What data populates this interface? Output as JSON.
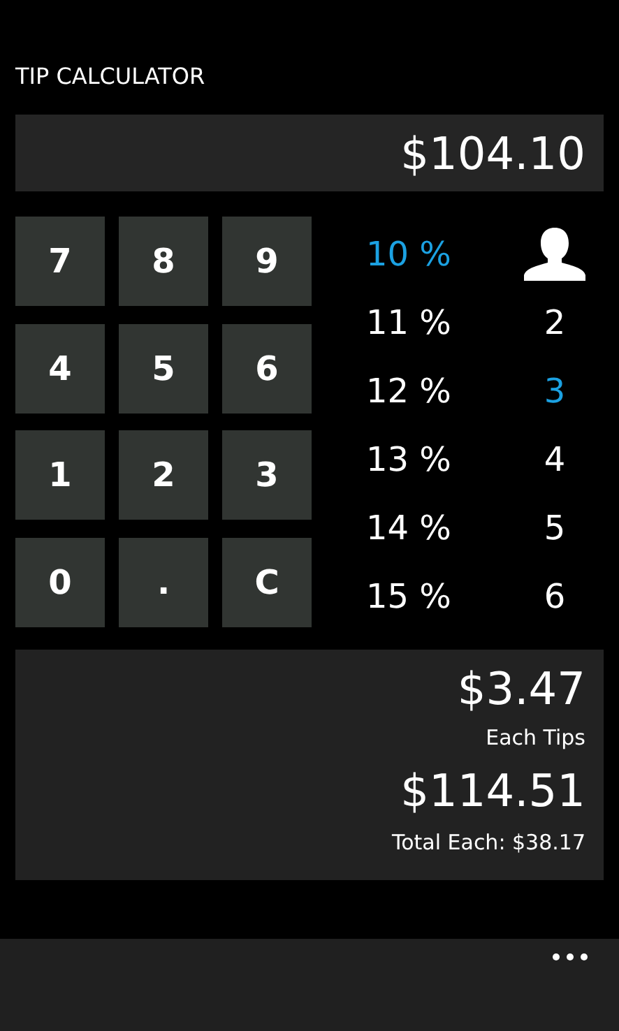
{
  "title": "TIP CALCULATOR",
  "amount": "$104.10",
  "keypad": [
    "7",
    "8",
    "9",
    "4",
    "5",
    "6",
    "1",
    "2",
    "3",
    "0",
    ".",
    "C"
  ],
  "tip_percents": [
    {
      "label": "10 %",
      "selected": true
    },
    {
      "label": "11 %",
      "selected": false
    },
    {
      "label": "12 %",
      "selected": false
    },
    {
      "label": "13 %",
      "selected": false
    },
    {
      "label": "14 %",
      "selected": false
    },
    {
      "label": "15 %",
      "selected": false
    }
  ],
  "people": [
    {
      "label": "2",
      "selected": false
    },
    {
      "label": "3",
      "selected": true
    },
    {
      "label": "4",
      "selected": false
    },
    {
      "label": "5",
      "selected": false
    },
    {
      "label": "6",
      "selected": false
    }
  ],
  "results": {
    "tip_each": "$3.47",
    "tip_label": "Each Tips",
    "total": "$114.51",
    "total_each": "Total Each: $38.17"
  }
}
